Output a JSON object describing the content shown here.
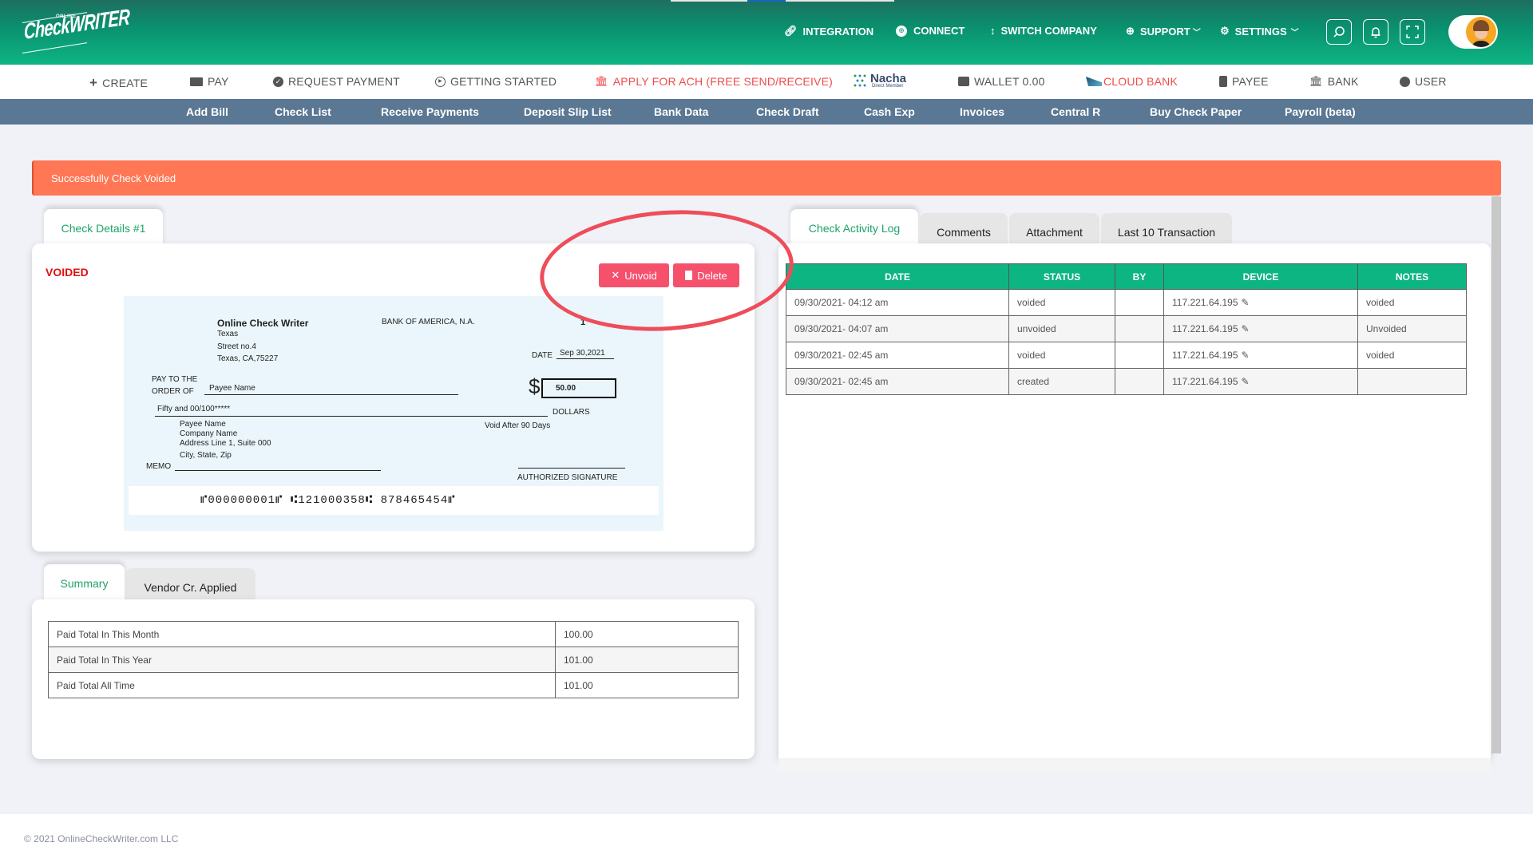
{
  "header": {
    "logo_small": "ONLINE",
    "logo_text": "CheckWRITER",
    "nav": [
      {
        "label": "INTEGRATION",
        "icon": "link-icon"
      },
      {
        "label": "CONNECT",
        "icon": "connect-icon"
      },
      {
        "label": "SWITCH COMPANY",
        "icon": "switch-icon"
      },
      {
        "label": "SUPPORT",
        "icon": "support-icon",
        "dropdown": true
      },
      {
        "label": "SETTINGS",
        "icon": "gear-icon",
        "dropdown": true
      }
    ],
    "icon_buttons": [
      "search-icon",
      "bell-icon",
      "fullscreen-icon"
    ]
  },
  "main_nav": [
    {
      "label": "CREATE",
      "icon": "plus-icon"
    },
    {
      "label": "PAY",
      "icon": "pay-icon"
    },
    {
      "label": "REQUEST PAYMENT",
      "icon": "check-circle-icon"
    },
    {
      "label": "GETTING STARTED",
      "icon": "play-icon"
    },
    {
      "label": "APPLY FOR ACH (FREE SEND/RECEIVE)",
      "icon": "bank-icon",
      "color": "#f04b4b"
    },
    {
      "label": "WALLET 0.00",
      "icon": "wallet-icon"
    },
    {
      "label": "CLOUD BANK",
      "icon": "cloud-bank-icon",
      "color": "#f04b4b"
    },
    {
      "label": "PAYEE",
      "icon": "payee-icon"
    },
    {
      "label": "BANK",
      "icon": "bank-icon"
    },
    {
      "label": "USER",
      "icon": "user-icon"
    }
  ],
  "nacha": {
    "title": "Nacha",
    "subtitle": "Direct Member"
  },
  "sub_nav": [
    "Add Bill",
    "Check List",
    "Receive Payments",
    "Deposit Slip List",
    "Bank Data",
    "Check Draft",
    "Cash Exp",
    "Invoices",
    "Central R",
    "Buy Check Paper",
    "Payroll (beta)"
  ],
  "alert": {
    "message": "Successfully Check Voided",
    "color": "#ff7755"
  },
  "check_details": {
    "tab_label": "Check Details #1",
    "status": "VOIDED",
    "unvoid_label": "Unvoid",
    "delete_label": "Delete",
    "check": {
      "company_name": "Online Check Writer",
      "company_addr1": "Texas",
      "company_addr2": "Street no.4",
      "company_addr3": "Texas, CA,75227",
      "bank_name": "BANK OF AMERICA, N.A.",
      "check_number": "1",
      "date_label": "DATE",
      "date_value": "Sep 30,2021",
      "pay_to_label_1": "PAY TO THE",
      "pay_to_label_2": "ORDER OF",
      "payee_name": "Payee Name",
      "currency_symbol": "$",
      "amount": "50.00",
      "amount_words": "Fifty  and 00/100*****",
      "dollars_label": "DOLLARS",
      "address_name": "Payee Name",
      "address_company": "Company Name",
      "address_line1": "Address Line 1, Suite 000",
      "address_city": "City, State, Zip",
      "void_after": "Void After 90 Days",
      "memo_label": "MEMO",
      "signature_label": "AUTHORIZED SIGNATURE",
      "micr": "⑈000000001⑈ ⑆121000358⑆ 878465454⑈"
    }
  },
  "summary": {
    "tabs": [
      "Summary",
      "Vendor Cr. Applied"
    ],
    "rows": [
      {
        "label": "Paid Total In This Month",
        "value": "100.00"
      },
      {
        "label": "Paid Total In This Year",
        "value": "101.00"
      },
      {
        "label": "Paid Total All Time",
        "value": "101.00"
      }
    ]
  },
  "activity": {
    "tabs": [
      "Check Activity Log",
      "Comments",
      "Attachment",
      "Last 10 Transaction"
    ],
    "columns": [
      "DATE",
      "STATUS",
      "BY",
      "DEVICE",
      "NOTES"
    ],
    "rows": [
      {
        "date": "09/30/2021- 04:12 am",
        "status": "voided",
        "by": "",
        "device": "117.221.64.195",
        "notes": "voided"
      },
      {
        "date": "09/30/2021- 04:07 am",
        "status": "unvoided",
        "by": "",
        "device": "117.221.64.195",
        "notes": "Unvoided"
      },
      {
        "date": "09/30/2021- 02:45 am",
        "status": "voided",
        "by": "",
        "device": "117.221.64.195",
        "notes": "voided"
      },
      {
        "date": "09/30/2021- 02:45 am",
        "status": "created",
        "by": "",
        "device": "117.221.64.195",
        "notes": ""
      }
    ],
    "header_color": "#0db583"
  },
  "footer": {
    "copyright": "© 2021 OnlineCheckWriter.com LLC"
  }
}
